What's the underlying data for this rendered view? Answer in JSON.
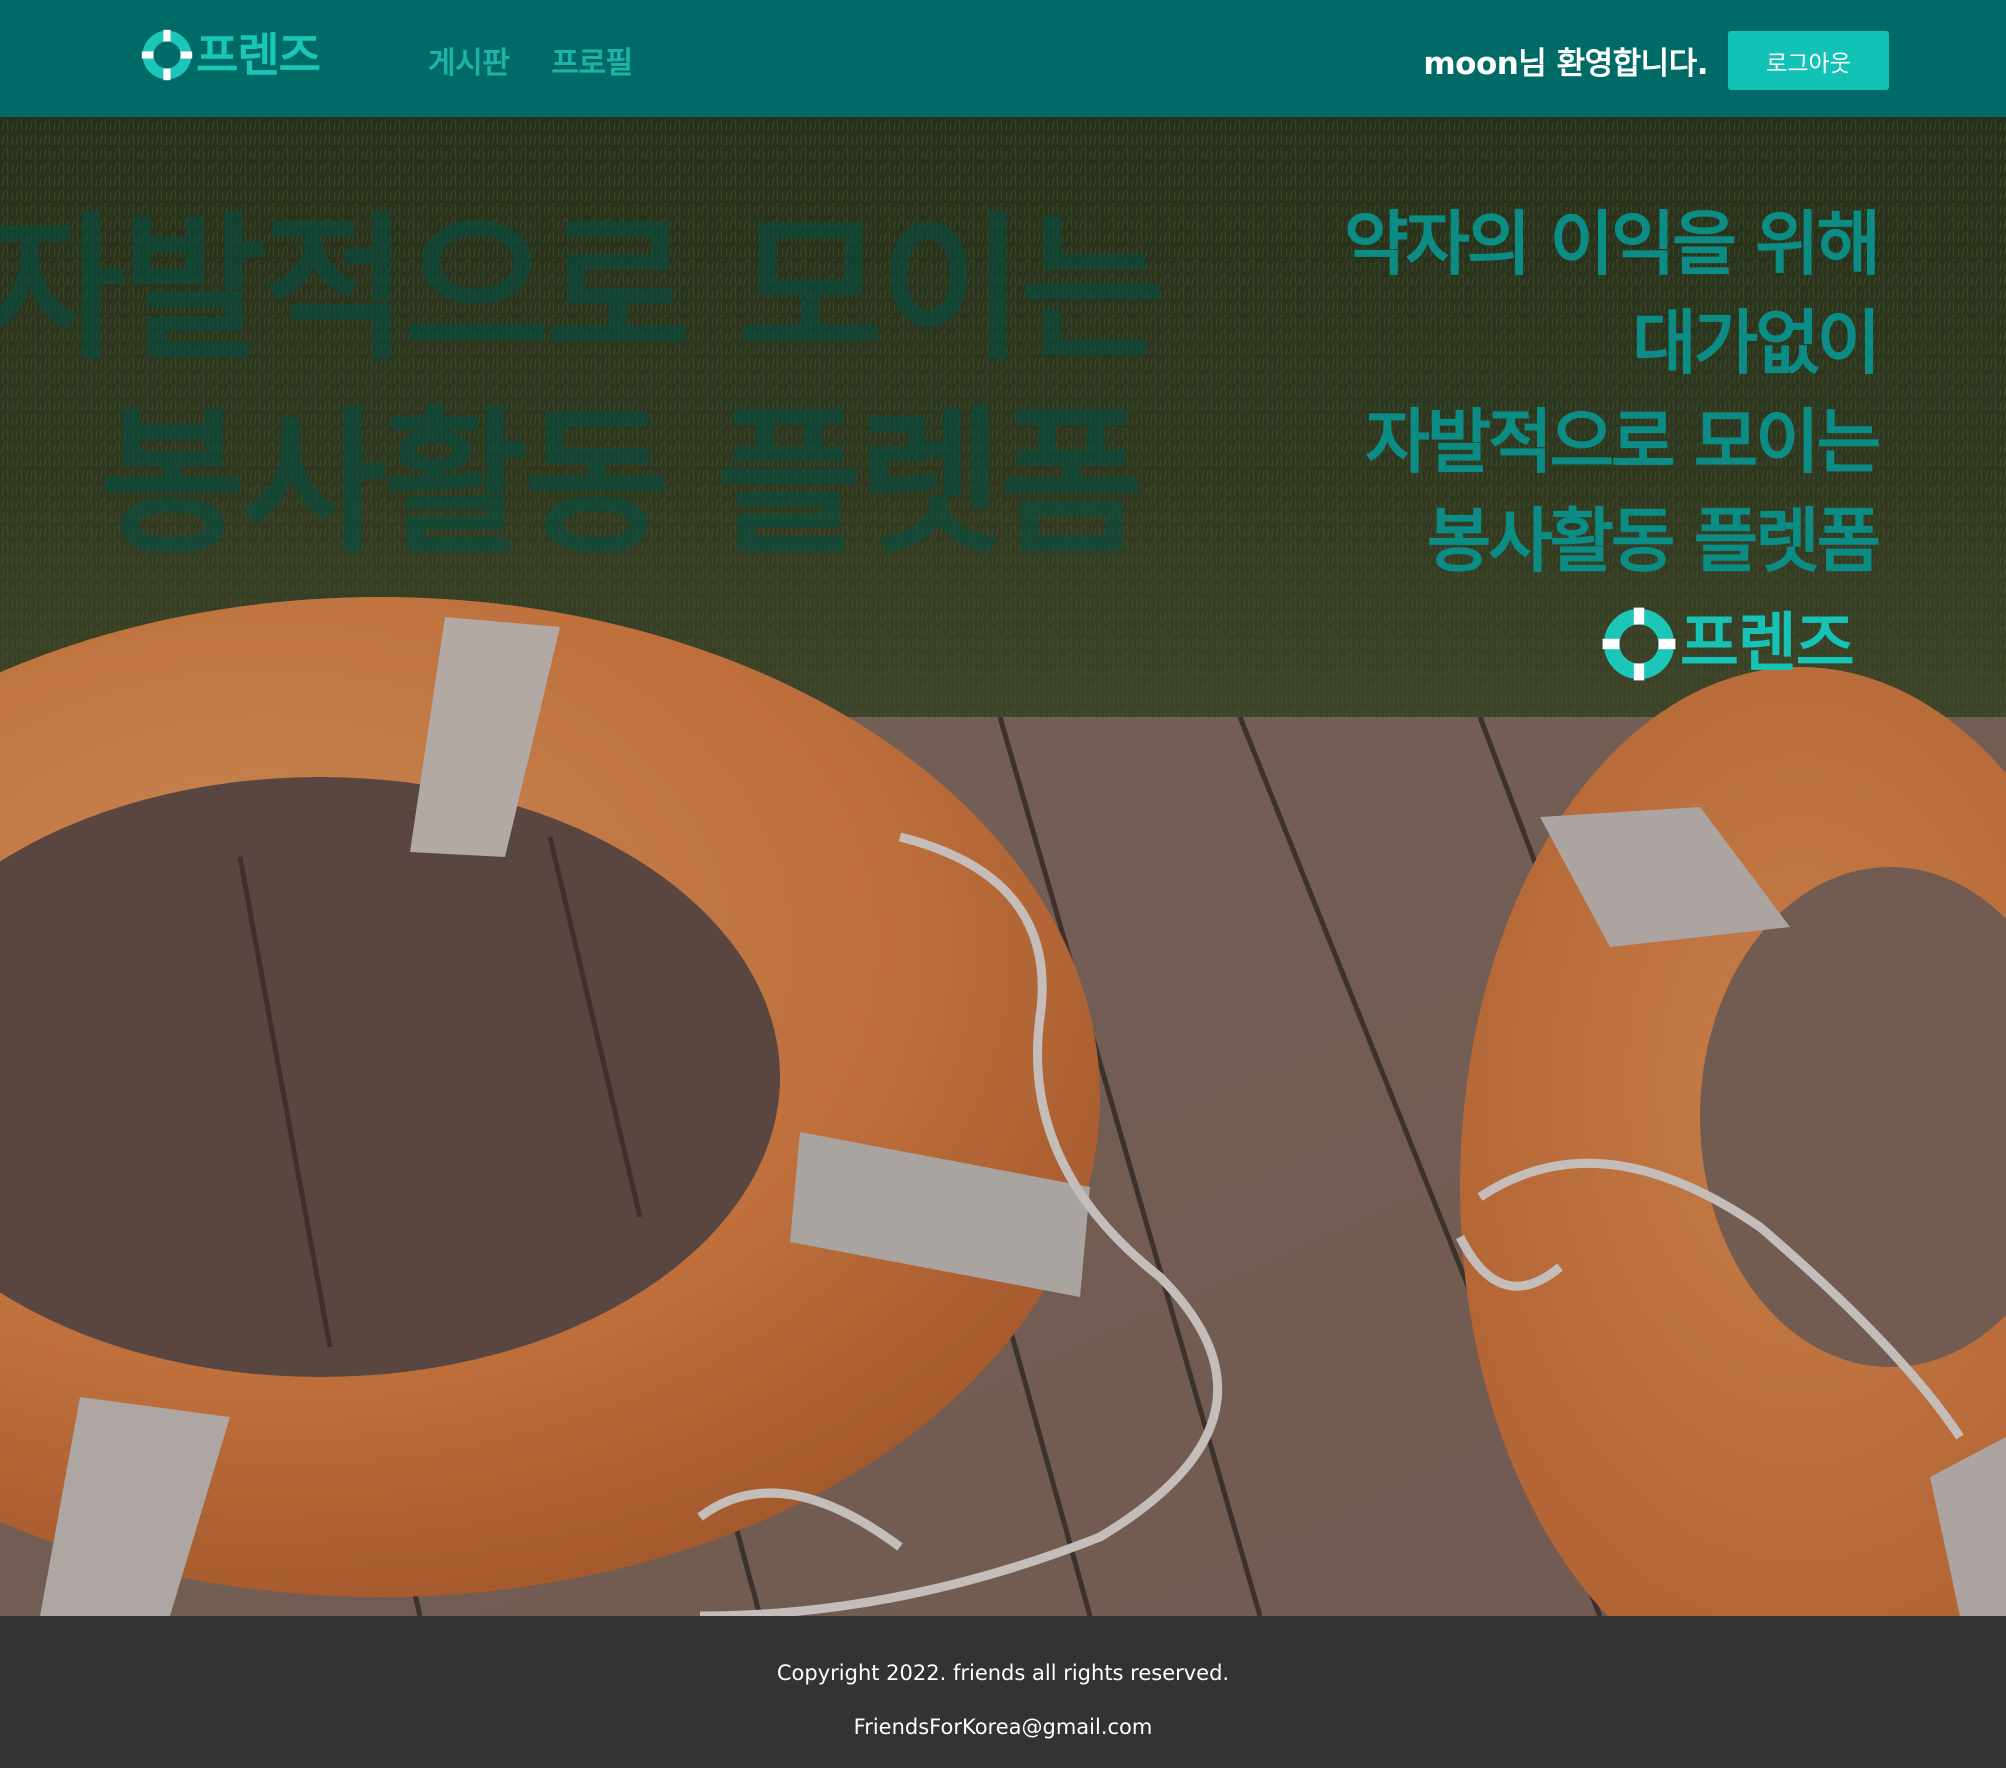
{
  "header": {
    "logo_text": "프렌즈",
    "nav": [
      {
        "label": "게시판"
      },
      {
        "label": "프로필"
      }
    ],
    "welcome": "moon님 환영합니다.",
    "logout_label": "로그아웃"
  },
  "hero": {
    "watermark_lines": [
      "자발적으로 모이는",
      "봉사활동 플렛폼"
    ],
    "tagline": [
      "약자의 이익을 위해",
      "대가없이",
      "자발적으로 모이는",
      "봉사활동 플렛폼"
    ],
    "logo_text": "프렌즈"
  },
  "footer": {
    "copyright": "Copyright 2022. friends all rights reserved.",
    "email": "FriendsForKorea@gmail.com"
  },
  "colors": {
    "header_bg": "#006b66",
    "accent": "#13c2b7",
    "tagline": "#0b8d86",
    "footer_bg": "#333333"
  },
  "icons": [
    "lifebuoy-logo-icon"
  ]
}
